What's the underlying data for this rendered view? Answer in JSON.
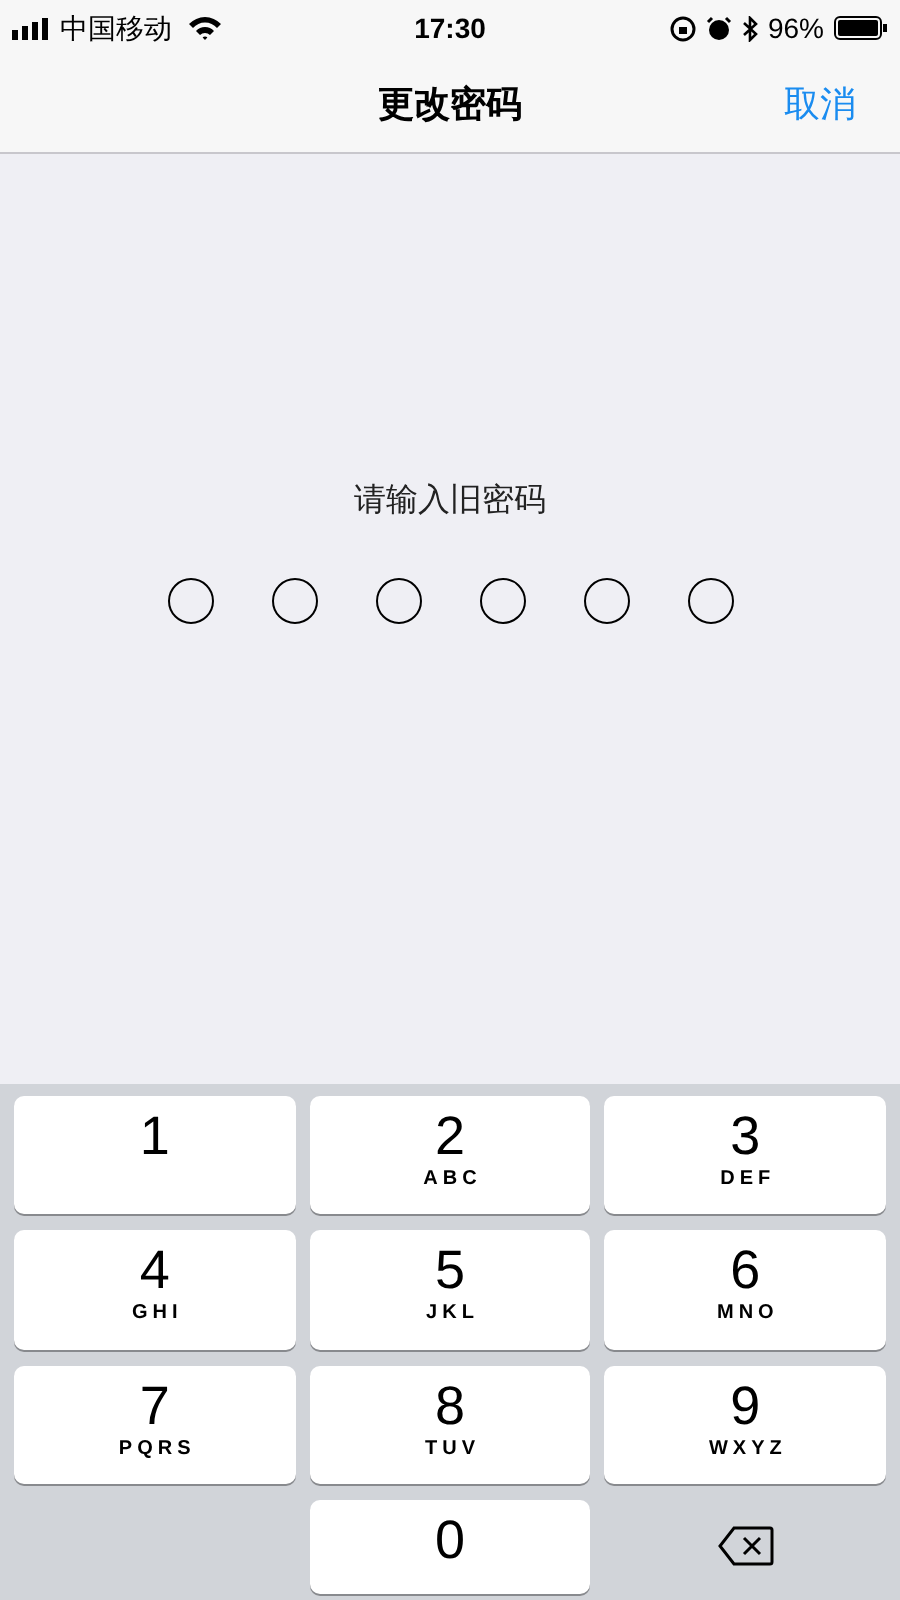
{
  "status_bar": {
    "carrier": "中国移动",
    "time": "17:30",
    "battery": "96%"
  },
  "nav": {
    "title": "更改密码",
    "cancel": "取消"
  },
  "prompt": "请输入旧密码",
  "dots": [
    {
      "filled": false
    },
    {
      "filled": false
    },
    {
      "filled": false
    },
    {
      "filled": false
    },
    {
      "filled": false
    },
    {
      "filled": false
    }
  ],
  "keys": [
    {
      "kind": "digit",
      "digit": "1"
    },
    {
      "kind": "digit",
      "digit": "2",
      "letters": "ABC"
    },
    {
      "kind": "digit",
      "digit": "3",
      "letters": "DEF"
    },
    {
      "kind": "digit",
      "digit": "4",
      "letters": "GHI"
    },
    {
      "kind": "digit",
      "digit": "5",
      "letters": "JKL"
    },
    {
      "kind": "digit",
      "digit": "6",
      "letters": "MNO"
    },
    {
      "kind": "digit",
      "digit": "7",
      "letters": "PQRS"
    },
    {
      "kind": "digit",
      "digit": "8",
      "letters": "TUV"
    },
    {
      "kind": "digit",
      "digit": "9",
      "letters": "WXYZ"
    },
    {
      "kind": "blank"
    },
    {
      "kind": "digit",
      "digit": "0"
    },
    {
      "kind": "delete"
    }
  ]
}
